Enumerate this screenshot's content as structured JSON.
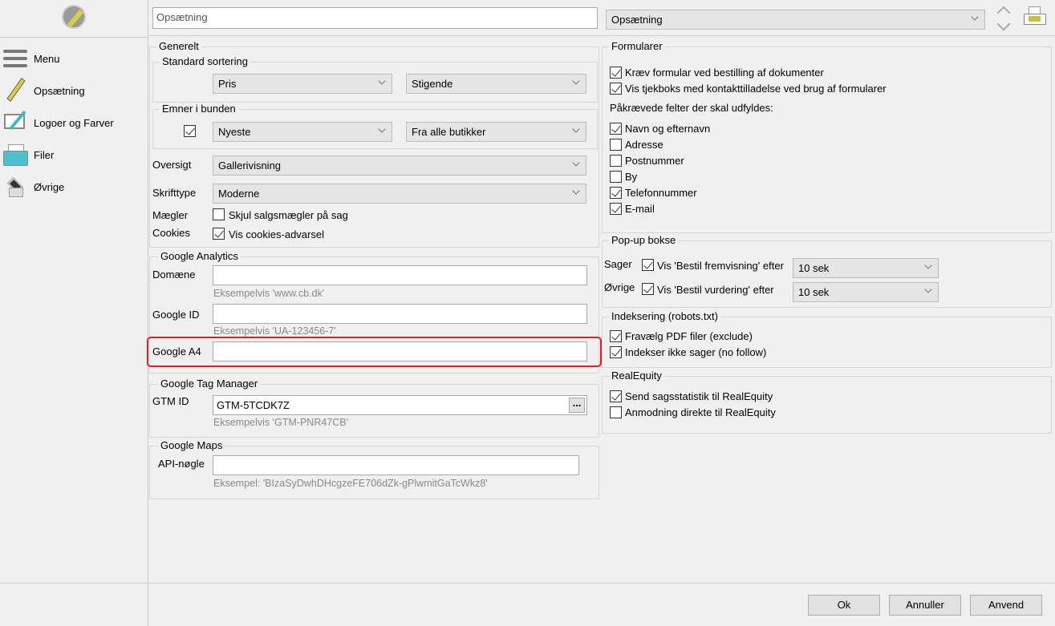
{
  "sidebar": {
    "items": [
      {
        "label": "Menu",
        "icon": "hamburger-icon"
      },
      {
        "label": "Opsætning",
        "icon": "pen-icon"
      },
      {
        "label": "Logoer og Farver",
        "icon": "monitor-pen-icon"
      },
      {
        "label": "Filer",
        "icon": "printer-tray-icon"
      },
      {
        "label": "Øvrige",
        "icon": "box-icon"
      }
    ]
  },
  "topbar": {
    "title_value": "Opsætning",
    "page_select": "Opsætning"
  },
  "generelt": {
    "title": "Generelt",
    "standard_sortering": {
      "title": "Standard sortering",
      "field": "Pris",
      "order": "Stigende"
    },
    "emner": {
      "title": "Emner i bunden",
      "checked": true,
      "sort": "Nyeste",
      "source": "Fra alle butikker"
    },
    "oversigt": {
      "label": "Oversigt",
      "value": "Gallerivisning"
    },
    "skrifttype": {
      "label": "Skrifttype",
      "value": "Moderne"
    },
    "maegler": {
      "label": "Mægler",
      "checkbox": "Skjul salgsmægler på sag",
      "checked": false
    },
    "cookies": {
      "label": "Cookies",
      "checkbox": "Vis cookies-advarsel",
      "checked": true
    }
  },
  "analytics": {
    "title": "Google Analytics",
    "domaene_label": "Domæne",
    "domaene_value": "",
    "domaene_hint": "Eksempelvis 'www.cb.dk'",
    "id_label": "Google ID",
    "id_value": "",
    "id_hint": "Eksempelvis 'UA-123456-7'",
    "a4_label": "Google A4",
    "a4_value": ""
  },
  "gtm": {
    "title": "Google Tag Manager",
    "label": "GTM ID",
    "value": "GTM-5TCDK7Z",
    "button": "...",
    "hint": "Eksempelvis 'GTM-PNR47CB'"
  },
  "maps": {
    "title": "Google Maps",
    "label": "API-nøgle",
    "value": "",
    "hint": "Eksempel: 'BIzaSyDwhDHcgzeFE706dZk-gPlwmitGaTcWkz8'"
  },
  "formularer": {
    "title": "Formularer",
    "options": [
      {
        "label": "Kræv formular ved bestilling af dokumenter",
        "checked": true
      },
      {
        "label": "Vis tjekboks med kontakttilladelse ved brug af formularer",
        "checked": true
      }
    ],
    "required_label": "Påkrævede felter der skal udfyldes:",
    "fields": [
      {
        "label": "Navn og efternavn",
        "checked": true
      },
      {
        "label": "Adresse",
        "checked": false
      },
      {
        "label": "Postnummer",
        "checked": false
      },
      {
        "label": "By",
        "checked": false
      },
      {
        "label": "Telefonnummer",
        "checked": true
      },
      {
        "label": "E-mail",
        "checked": true
      }
    ]
  },
  "popup": {
    "title": "Pop-up bokse",
    "rows": [
      {
        "label": "Sager",
        "checkbox": "Vis 'Bestil fremvisning' efter",
        "checked": true,
        "value": "10 sek"
      },
      {
        "label": "Øvrige",
        "checkbox": "Vis 'Bestil vurdering' efter",
        "checked": true,
        "value": "10 sek"
      }
    ]
  },
  "indeksering": {
    "title": "Indeksering (robots.txt)",
    "options": [
      {
        "label": "Fravælg PDF filer (exclude)",
        "checked": true
      },
      {
        "label": "Indekser ikke sager (no follow)",
        "checked": true
      }
    ]
  },
  "realequity": {
    "title": "RealEquity",
    "options": [
      {
        "label": "Send sagsstatistik til RealEquity",
        "checked": true
      },
      {
        "label": "Anmodning direkte til RealEquity",
        "checked": false
      }
    ]
  },
  "footer": {
    "ok": "Ok",
    "cancel": "Annuller",
    "apply": "Anvend"
  },
  "colors": {
    "highlight": "#e02020"
  }
}
